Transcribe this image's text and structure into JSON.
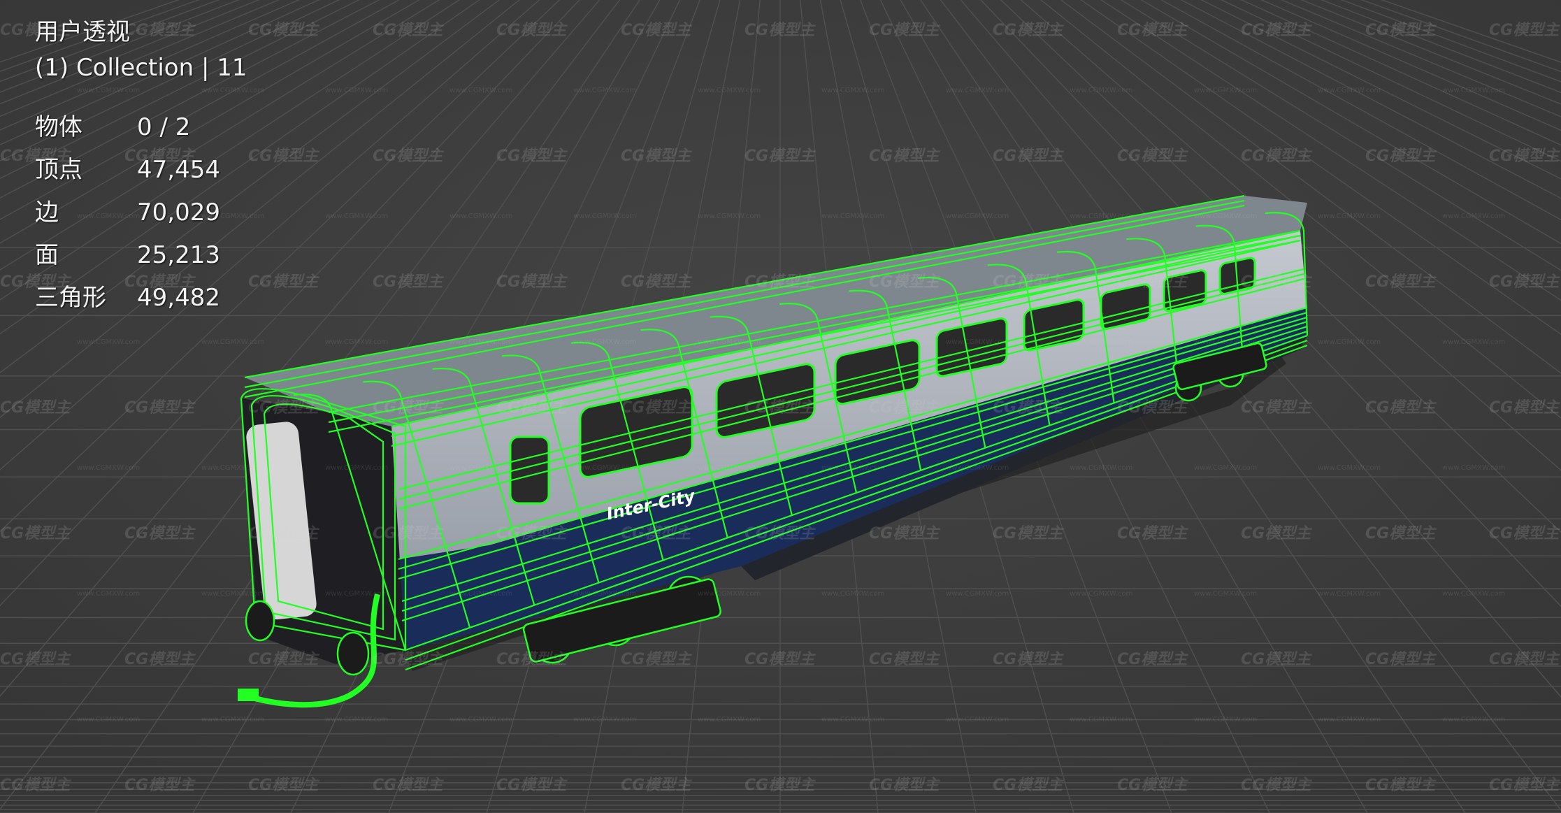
{
  "viewport": {
    "view_name": "用户透视",
    "collection_label": "(1) Collection | 11",
    "stats": [
      {
        "label": "物体",
        "value": "0 / 2"
      },
      {
        "label": "顶点",
        "value": "47,454"
      },
      {
        "label": "边",
        "value": "70,029"
      },
      {
        "label": "面",
        "value": "25,213"
      },
      {
        "label": "三角形",
        "value": "49,482"
      }
    ]
  },
  "model": {
    "livery_text": "Inter-City"
  },
  "watermark": {
    "text": "CG模型主",
    "subtext": "www.CGMXW.com"
  },
  "colors": {
    "background": "#3b3b3b",
    "grid": "#4a4a4a",
    "wireframe": "#22ff22",
    "body_blue": "#1a2c5a",
    "body_grey": "#b8bcc4",
    "roof": "#8f969c"
  }
}
